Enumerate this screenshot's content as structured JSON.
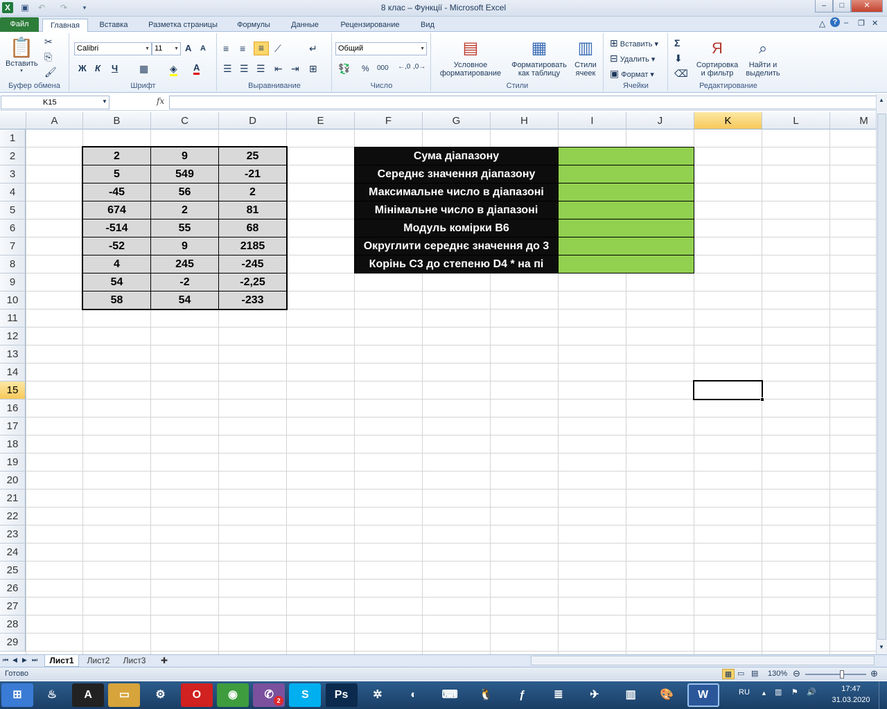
{
  "window": {
    "title": "8 клас – Функції  -  Microsoft Excel",
    "minimize": "–",
    "maximize": "□",
    "close": "✕"
  },
  "ribbon_tabs": {
    "file": "Файл",
    "tabs": [
      "Главная",
      "Вставка",
      "Разметка страницы",
      "Формулы",
      "Данные",
      "Рецензирование",
      "Вид"
    ]
  },
  "ribbon": {
    "clipboard": {
      "paste": "Вставить",
      "group": "Буфер обмена"
    },
    "font": {
      "name": "Calibri",
      "size": "11",
      "bold": "Ж",
      "italic": "К",
      "underline": "Ч",
      "grow": "A",
      "shrink": "A",
      "group": "Шрифт"
    },
    "alignment": {
      "group": "Выравнивание"
    },
    "number": {
      "format": "Общий",
      "percent": "%",
      "thousands": "000",
      "group": "Число"
    },
    "styles": {
      "conditional_l1": "Условное",
      "conditional_l2": "форматирование",
      "table_l1": "Форматировать",
      "table_l2": "как таблицу",
      "cell_l1": "Стили",
      "cell_l2": "ячеек",
      "group": "Стили"
    },
    "cells": {
      "insert": "Вставить",
      "delete": "Удалить",
      "format": "Формат",
      "group": "Ячейки"
    },
    "editing": {
      "sum": "Σ",
      "sort_l1": "Сортировка",
      "sort_l2": "и фильтр",
      "find_l1": "Найти и",
      "find_l2": "выделить",
      "group": "Редактирование"
    }
  },
  "formula_bar": {
    "name_box": "K15",
    "fx": "fx",
    "formula": ""
  },
  "columns": [
    "A",
    "B",
    "C",
    "D",
    "E",
    "F",
    "G",
    "H",
    "I",
    "J",
    "K",
    "L",
    "M"
  ],
  "selected_column": "K",
  "rows": [
    "1",
    "2",
    "3",
    "4",
    "5",
    "6",
    "7",
    "8",
    "9",
    "10",
    "11",
    "12",
    "13",
    "14",
    "15",
    "16",
    "17",
    "18",
    "19",
    "20",
    "21",
    "22",
    "23",
    "24",
    "25",
    "26",
    "27",
    "28",
    "29"
  ],
  "selected_row": "15",
  "data_table": [
    [
      "2",
      "9",
      "25"
    ],
    [
      "5",
      "549",
      "-21"
    ],
    [
      "-45",
      "56",
      "2"
    ],
    [
      "674",
      "2",
      "81"
    ],
    [
      "-514",
      "55",
      "68"
    ],
    [
      "-52",
      "9",
      "2185"
    ],
    [
      "4",
      "245",
      "-245"
    ],
    [
      "54",
      "-2",
      "-2,25"
    ],
    [
      "58",
      "54",
      "-233"
    ]
  ],
  "task_labels": [
    "Сума діапазону",
    "Середнє значення діапазону",
    "Максимальне число в діапазоні",
    "Мінімальне число в діапазоні",
    "Модуль комірки B6",
    "Округлити середнє значення до 3",
    "Корінь С3 до степеню D4 * на пі"
  ],
  "colors": {
    "answer_fill": "#92d050",
    "label_fill": "#0d0d0d",
    "data_fill": "#d9d9d9",
    "selection": "#000000"
  },
  "sheets": [
    "Лист1",
    "Лист2",
    "Лист3"
  ],
  "active_sheet": "Лист1",
  "status": {
    "ready": "Готово",
    "zoom": "130%",
    "zoom_level": 0.6
  },
  "taskbar": {
    "lang": "RU",
    "time": "17:47",
    "date": "31.03.2020",
    "viber_badge": "2",
    "icons": [
      "start-icon",
      "cleaner-icon",
      "a-app-icon",
      "folder-icon",
      "network-icon",
      "opera-icon",
      "chrome-icon",
      "viber-icon",
      "skype-icon",
      "photoshop-icon",
      "settings-icon",
      "browser-icon",
      "keyboard-icon",
      "tux-icon",
      "flash-icon",
      "stack-icon",
      "plane-icon",
      "winrar-icon",
      "paint-icon",
      "word-icon"
    ]
  }
}
